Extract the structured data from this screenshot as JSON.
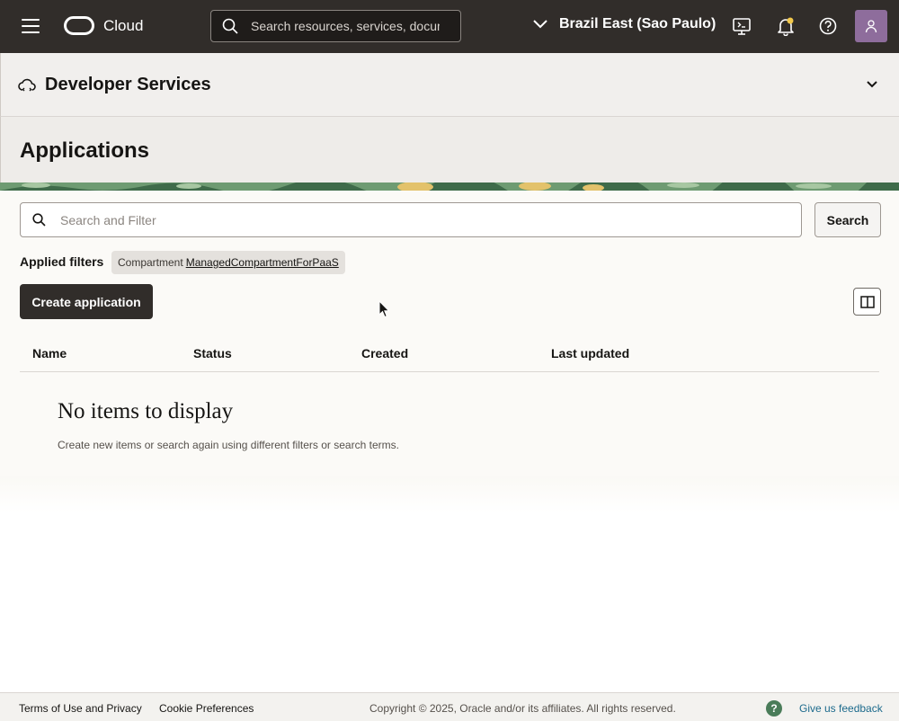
{
  "topbar": {
    "brand": "Cloud",
    "search_placeholder": "Search resources, services, documentation, and Marketplace",
    "region": "Brazil East (Sao Paulo)"
  },
  "service": {
    "title": "Developer Services"
  },
  "page": {
    "title": "Applications"
  },
  "filter": {
    "placeholder": "Search and Filter",
    "search_button": "Search",
    "applied_label": "Applied filters",
    "chip_key": "Compartment",
    "chip_value": "ManagedCompartmentForPaaS"
  },
  "actions": {
    "create_button": "Create application"
  },
  "table": {
    "columns": [
      "Name",
      "Status",
      "Created",
      "Last updated"
    ],
    "empty_title": "No items to display",
    "empty_subtitle": "Create new items or search again using different filters or search terms."
  },
  "footer": {
    "terms": "Terms of Use and Privacy",
    "cookies": "Cookie Preferences",
    "copyright": "Copyright © 2025, Oracle and/or its affiliates. All rights reserved.",
    "help": "?",
    "feedback": "Give us feedback"
  },
  "colors": {
    "topbar": "#312d2a",
    "avatar": "#8e6d9c",
    "banner_green": "#3f6b4a",
    "banner_yellow": "#e3c26b"
  }
}
